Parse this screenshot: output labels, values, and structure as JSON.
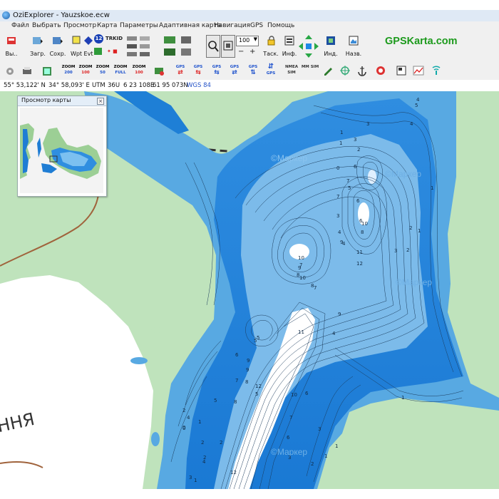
{
  "window": {
    "title": "OziExplorer - Yauzskoe.ecw"
  },
  "menu": [
    "Файл",
    "Выбрать",
    "Просмотр",
    "Карта",
    "Параметры",
    "Адаптивная карта",
    "Навигация",
    "GPS",
    "Помощь"
  ],
  "toolbar1": {
    "load_label": "Вы..",
    "open_label": "Загр.",
    "save_label": "Сохр.",
    "wpt_label": "Wpt",
    "evt_label": "Evt",
    "badge_12": "12",
    "trkid_label": "TRKID",
    "zoom_value": "100",
    "zoom_options": [
      "100"
    ],
    "task_label": "Таск.",
    "info_label": "Инф.",
    "index_label": "Инд.",
    "back_label": "Назв.",
    "brand": "GPSKarta.com"
  },
  "toolbar2": {
    "zoom_buttons": [
      {
        "top": "ZOOM",
        "value": "200"
      },
      {
        "top": "ZOOM",
        "value": "100"
      },
      {
        "top": "ZOOM",
        "value": "50"
      },
      {
        "top": "ZOOM",
        "value": "FULL"
      },
      {
        "top": "ZOOM",
        "value": "100"
      }
    ],
    "gps_labels": [
      "GPS",
      "GPS",
      "GPS",
      "GPS",
      "GPS"
    ],
    "nmea_label": "NMEA SIM",
    "mm_label": "MM SIM"
  },
  "status": {
    "lat": "55° 53,122' N",
    "lon": "34° 58,093' E",
    "utm_label": "UTM",
    "zone": "36U",
    "easting": "6 23 108E",
    "northing": "61 95 073N",
    "datum": "WGS 84"
  },
  "overview": {
    "title": "Просмотр карты"
  },
  "map": {
    "watermark": "©Маркер",
    "town_text": "ННЯ",
    "depth_labels": [
      "1",
      "1",
      "2",
      "3",
      "3",
      "4",
      "4",
      "5",
      "5",
      "6",
      "6",
      "7",
      "7",
      "8",
      "8",
      "9",
      "9",
      "10",
      "10",
      "11",
      "12",
      "0",
      "1",
      "2",
      "3",
      "4",
      "5",
      "6",
      "7",
      "8",
      "9",
      "10",
      "12",
      "1",
      "2",
      "1",
      "2",
      "2",
      "3",
      "4",
      "0",
      "1",
      "1",
      "2",
      "3",
      "4",
      "5",
      "6",
      "7",
      "8",
      "9",
      "10",
      "11",
      "12",
      "1",
      "2",
      "3",
      "4",
      "5",
      "6",
      "7",
      "3",
      "4",
      "5",
      "6",
      "7",
      "8",
      "9",
      "0",
      "1",
      "2"
    ],
    "colors": {
      "land": "#bfe3bc",
      "water_shallow": "#58a9e2",
      "water_deep": "#1e7fd6",
      "snow": "#ffffff",
      "road": "#a0633c",
      "contour": "#1b3b5c"
    }
  }
}
